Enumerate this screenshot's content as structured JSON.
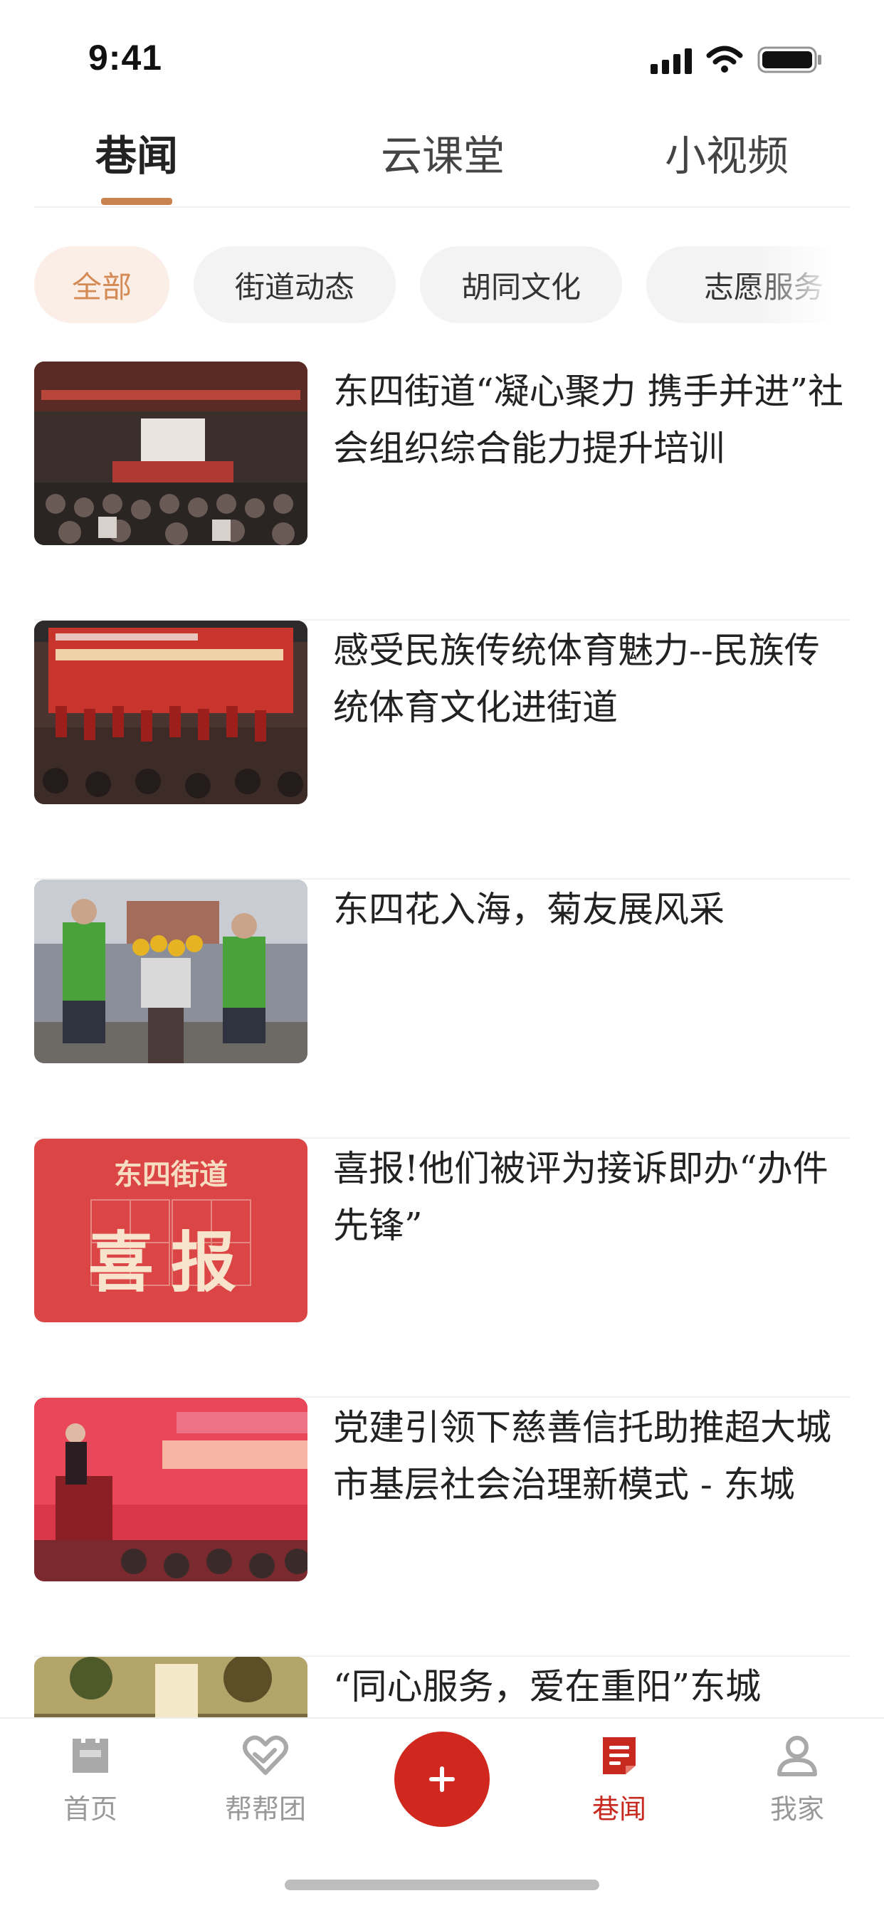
{
  "status_bar": {
    "time": "9:41"
  },
  "top_tabs": [
    {
      "label": "巷闻",
      "active": true
    },
    {
      "label": "云课堂",
      "active": false
    },
    {
      "label": "小视频",
      "active": false
    }
  ],
  "chips": [
    {
      "label": "全部",
      "active": true
    },
    {
      "label": "街道动态",
      "active": false
    },
    {
      "label": "胡同文化",
      "active": false
    },
    {
      "label": "志愿服务",
      "active": false
    }
  ],
  "news": [
    {
      "title": "东四街道“凝心聚力 携手并进”社会组织综合能力提升培训"
    },
    {
      "title": "感受民族传统体育魅力--民族传统体育文化进街道"
    },
    {
      "title": "东四花入海，菊友展风采"
    },
    {
      "title": "喜报!他们被评为接诉即办“办件先锋”",
      "thumb_text": {
        "top": "东四街道",
        "main": "喜报"
      }
    },
    {
      "title": "党建引领下慈善信托助推超大城市基层社会治理新模式 - 东城"
    },
    {
      "title": "“同心服务，爱在重阳”东城"
    }
  ],
  "bottom_nav": [
    {
      "label": "首页",
      "icon": "home-icon",
      "active": false
    },
    {
      "label": "帮帮团",
      "icon": "heart-hands-icon",
      "active": false
    },
    {
      "label": "",
      "icon": "plus-icon",
      "active": false
    },
    {
      "label": "巷闻",
      "icon": "news-icon",
      "active": true
    },
    {
      "label": "我家",
      "icon": "user-icon",
      "active": false
    }
  ],
  "colors": {
    "accent": "#c9834e",
    "chip_active_bg": "#fbeee6",
    "brand_red": "#d0281e",
    "nav_active": "#c8291f",
    "nav_inactive": "#999999"
  }
}
